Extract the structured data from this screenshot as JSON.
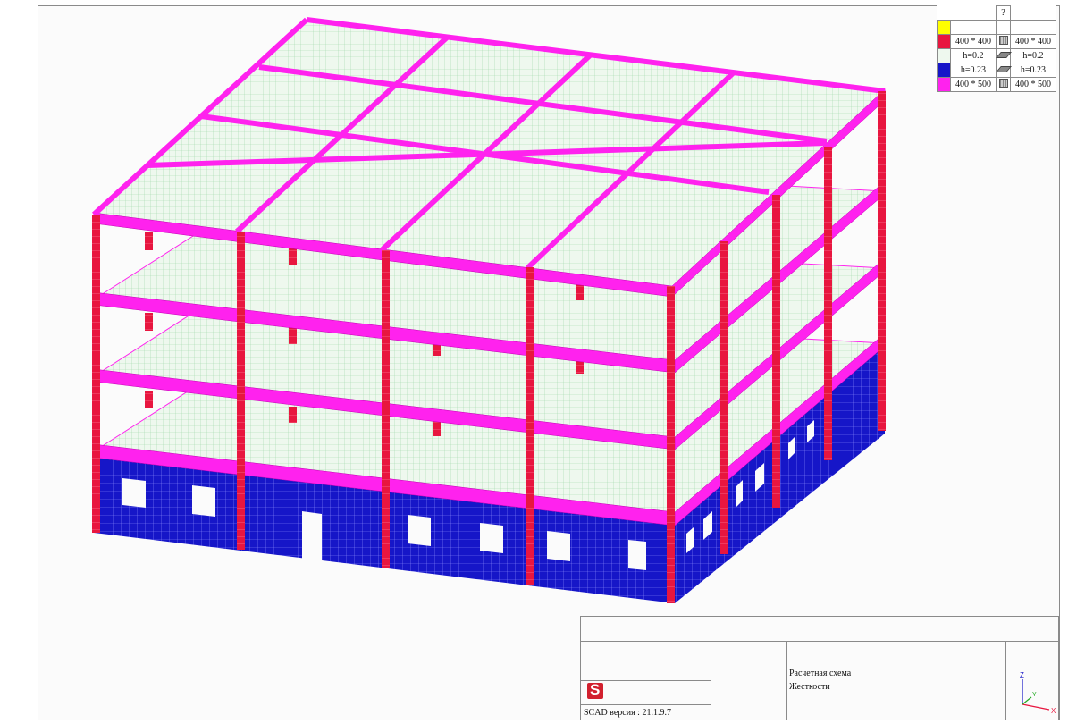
{
  "legend": {
    "header": "?",
    "rows": [
      {
        "color": "#ffff00",
        "label": "",
        "icon": "unknown-type-icon",
        "right": ""
      },
      {
        "color": "#e8163f",
        "label": "400 * 400",
        "icon": "bar-section-icon",
        "right": "400 * 400"
      },
      {
        "color": "#eef8ee",
        "label": "h=0.2",
        "icon": "plate-icon",
        "right": "h=0.2"
      },
      {
        "color": "#1616c8",
        "label": "h=0.23",
        "icon": "plate-icon",
        "right": "h=0.23"
      },
      {
        "color": "#ff22ee",
        "label": "400 * 500",
        "icon": "bar-section-icon",
        "right": "400 * 500"
      }
    ]
  },
  "stamp": {
    "line1": "Расчетная схема",
    "line2": "Жесткости",
    "version": "SCAD версия : 21.1.9.7",
    "axis_x": "X",
    "axis_y": "Y",
    "axis_z": "Z"
  },
  "colors": {
    "column": "#e8163f",
    "beam": "#ff22ee",
    "slab": "#eef8ee",
    "wall": "#1616c8",
    "mesh": "#9fd8a8"
  }
}
